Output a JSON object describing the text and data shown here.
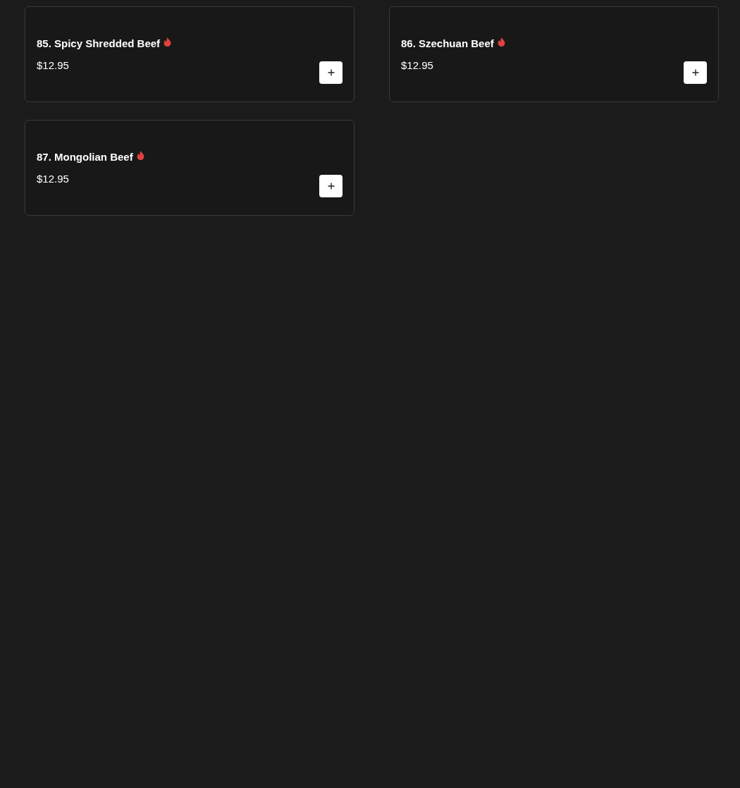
{
  "menu_items": [
    {
      "name": "85. Spicy Shredded Beef",
      "spicy": true,
      "price": "$12.95"
    },
    {
      "name": "86. Szechuan Beef",
      "spicy": true,
      "price": "$12.95"
    },
    {
      "name": "87. Mongolian Beef",
      "spicy": true,
      "price": "$12.95"
    }
  ]
}
